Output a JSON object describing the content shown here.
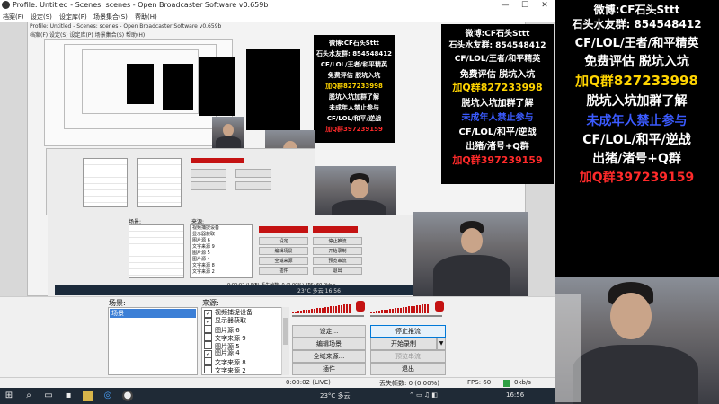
{
  "window": {
    "title": "Profile: Untitled - Scenes: scenes - Open Broadcaster Software v0.659b",
    "minimize": "—",
    "maximize": "☐",
    "close": "✕"
  },
  "menu": [
    {
      "label": "档案(F)"
    },
    {
      "label": "设定(S)"
    },
    {
      "label": "设定库(P)"
    },
    {
      "label": "场景集合(S)"
    },
    {
      "label": "帮助(H)"
    }
  ],
  "nested": {
    "title": "Profile: Untitled - Scenes: scenes - Open Broadcaster Software v0.659b",
    "menu": "档案(F)  设定(S)  设定库(P)  场景集合(S)  帮助(H)",
    "scenes_label": "场景:",
    "sources_label": "来源:",
    "sources": [
      "视频捕捉设备",
      "显示器获取",
      "图片源 6",
      "文字来源 9",
      "图片源 5",
      "图片源 4",
      "文字来源 8",
      "文字来源 2"
    ],
    "buttons": [
      "设定",
      "停止推流",
      "编辑场景",
      "开始录制",
      "全域来源",
      "预览串流",
      "插件",
      "退出"
    ],
    "status": "0:00:02 (LIVE)   丢失帧数: 0 (0.00%)   FPS: 60   0kb/s",
    "tray": "23°C 多云   16:56"
  },
  "overlay_text": {
    "line1": "微博:CF石头Sttt",
    "line2": "石头水友群: 854548412",
    "line3": "CF/LOL/王者/和平精英",
    "line4": "免费评估 脱坑入坑",
    "line5": "加Q群827233998",
    "line6": "脱坑入坑加群了解",
    "line7": "未成年人禁止参与",
    "line8": "CF/LOL/和平/逆战",
    "line9": "出猪/渚号+Q群",
    "line10": "加Q群397239159"
  },
  "docks": {
    "scenes_label": "场景:",
    "sources_label": "来源:",
    "scene_selected": "场景",
    "sources": [
      {
        "label": "视频捕捉设备",
        "checked": true
      },
      {
        "label": "显示器获取",
        "checked": true
      },
      {
        "label": "图片源 6",
        "checked": false
      },
      {
        "label": "文字来源 9",
        "checked": false
      },
      {
        "label": "图片源 5",
        "checked": false
      },
      {
        "label": "图片源 4",
        "checked": true
      },
      {
        "label": "文字来源 8",
        "checked": false
      },
      {
        "label": "文字来源 2",
        "checked": false
      }
    ],
    "buttons": {
      "settings": "设定...",
      "stop_stream": "停止推流",
      "edit_scene": "编辑场景",
      "start_record": "开始录制",
      "global_sources": "全域来源...",
      "preview_stream": "预览串流",
      "plugins": "插件",
      "exit": "退出"
    }
  },
  "status": {
    "time": "0:00:02 (LIVE)",
    "dropped_frames": "丢失帧数: 0 (0.00%)",
    "fps": "FPS: 60",
    "bitrate": "0kb/s"
  },
  "taskbar": {
    "weather": "23°C 多云",
    "clock": "16:56",
    "icons": [
      "windows-icon",
      "search-icon",
      "task-view-icon",
      "file-explorer-icon",
      "edge-icon",
      "obs-icon"
    ]
  },
  "colors": {
    "overlay_white": "#ffffff",
    "overlay_red": "#ff2a2a",
    "overlay_yellow": "#ffd400",
    "overlay_blue": "#3b5bff",
    "meter_red": "#c41212"
  }
}
